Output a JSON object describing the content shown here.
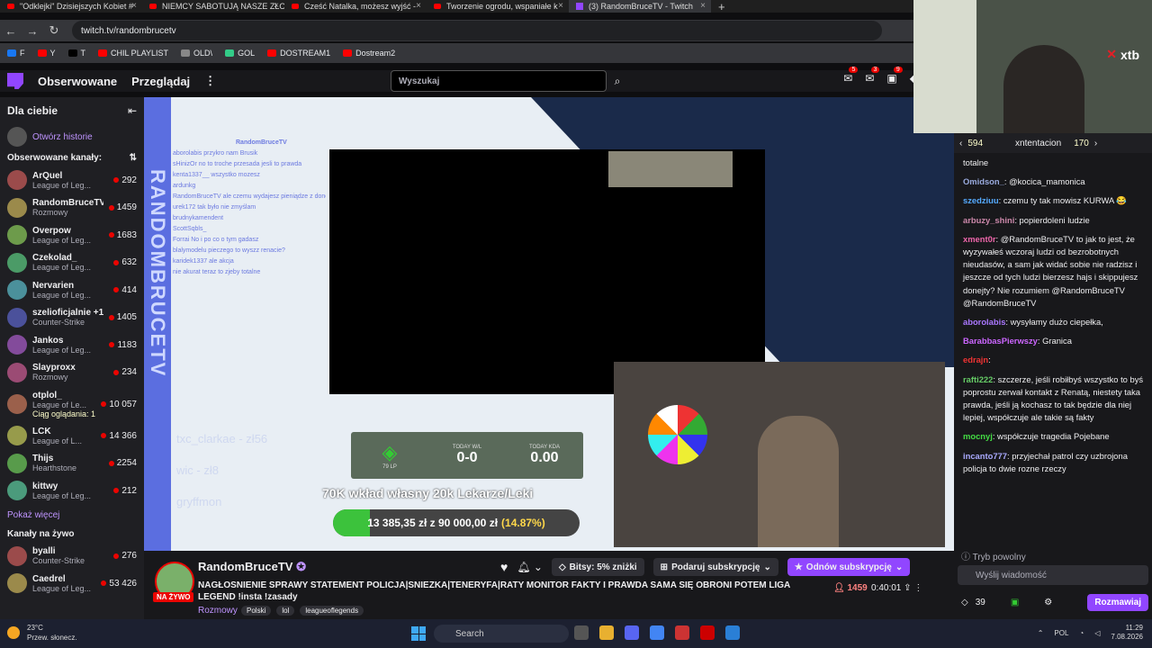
{
  "browser": {
    "tabs": [
      {
        "label": "\"Odklejki\" Dzisiejszych Kobiet #",
        "kind": "youtube"
      },
      {
        "label": "NIEMCY SABOTUJĄ NASZE ZŁO",
        "kind": "youtube"
      },
      {
        "label": "Cześć Natalka, możesz wyjść -",
        "kind": "youtube"
      },
      {
        "label": "Tworzenie ogrodu, wspaniałe k",
        "kind": "youtube"
      },
      {
        "label": "(3) RandomBruceTV - Twitch",
        "kind": "twitch",
        "active": true
      }
    ],
    "url": "twitch.tv/randombrucetv",
    "bookmarks": [
      "F",
      "Y",
      "T",
      "CHIL PLAYLIST",
      "OLD\\",
      "GOL",
      "DOSTREAM1",
      "Dostream2"
    ]
  },
  "twitch": {
    "nav": {
      "following": "Obserwowane",
      "browse": "Przeglądaj",
      "search_placeholder": "Wyszukaj",
      "badges": [
        "5",
        "3",
        "9"
      ]
    },
    "sidebar": {
      "for_you": "Dla ciebie",
      "open_stories": "Otwórz historie",
      "followed_header": "Obserwowane kanały:",
      "channels": [
        {
          "name": "ArQuel",
          "game": "League of Leg...",
          "viewers": "292"
        },
        {
          "name": "RandomBruceTV",
          "game": "Rozmowy",
          "viewers": "1459"
        },
        {
          "name": "Overpow",
          "game": "League of Leg...",
          "viewers": "1683"
        },
        {
          "name": "Czekolad_",
          "game": "League of Leg...",
          "viewers": "632"
        },
        {
          "name": "Nervarien",
          "game": "League of Leg...",
          "viewers": "414"
        },
        {
          "name": "szelioficjalnie +1",
          "game": "Counter-Strike",
          "viewers": "1405"
        },
        {
          "name": "Jankos",
          "game": "League of Leg...",
          "viewers": "1183"
        },
        {
          "name": "Slayproxx",
          "game": "Rozmowy",
          "viewers": "234"
        },
        {
          "name": "otplol_",
          "game": "League of Le...",
          "viewers": "10 057",
          "extra": "Ciąg oglądania: 1"
        },
        {
          "name": "LCK",
          "game": "League of L...",
          "viewers": "14 366"
        },
        {
          "name": "Thijs",
          "game": "Hearthstone",
          "viewers": "2254"
        },
        {
          "name": "kittwy",
          "game": "League of Leg...",
          "viewers": "212"
        }
      ],
      "show_more": "Pokaż więcej",
      "live_header": "Kanały na żywo",
      "live": [
        {
          "name": "byalli",
          "game": "Counter-Strike",
          "viewers": "276"
        },
        {
          "name": "Caedrel",
          "game": "League of Leg...",
          "viewers": "53 426"
        }
      ]
    },
    "stream_overlay": {
      "vertical_title": "RANDOMBRUCETV",
      "chat_header": "RandomBruceTV",
      "chat_lines": [
        "aborolabis przykro nam Brusik",
        "sHinizOr no to troche przesada jesli to prawda",
        "kenta1337__ wszystko mozesz",
        "ardunkg",
        "RandomBruceTV ale czemu wydajesz pieniądze z donejt goala na Teneryfe na procesor, monitor i płytę główną",
        "urek172 tak było nie zmyślam",
        "brudnykamendent",
        "ScottSqbls_",
        "Forrai No i po co o tym gadasz",
        "blalymodelu pieczego to wyszz renacie?",
        "karidek1337 ale akcja",
        "nie akurat teraz to zjeby totalne"
      ],
      "names": [
        "txc_clarkae - zł56",
        "wic - zł8",
        "gryffmon"
      ],
      "stats": {
        "rank_lp": "79 LP",
        "wl_label": "TODAY W/L",
        "wl": "0-0",
        "kda_label": "TODAY KDA",
        "kda": "0.00"
      },
      "goal_title": "70K wkład własny 20k Lekarze/Leki",
      "goal_text": "13 385,35 zł z 90 000,00 zł",
      "goal_pct": "(14.87%)",
      "goal_fraction": 0.1487
    },
    "stream_info": {
      "streamer": "RandomBruceTV",
      "live_label": "NA ŻYWO",
      "title": "NAGŁOSNIENIE SPRAWY STATEMENT POLICJA|SNIEZKA|TENERYFA|RATY MONITOR FAKTY I PRAWDA SAMA SIĘ OBRONI POTEM LIGA LEGEND !insta !zasady",
      "category": "Rozmowy",
      "tags": [
        "Polski",
        "lol",
        "leagueoflegends"
      ],
      "bits": "Bitsy: 5% zniżki",
      "gift": "Podaruj subskrypcję",
      "renew": "Odnów subskrypcję",
      "viewers": "1459",
      "uptime": "0:40:01"
    },
    "chat": {
      "top": {
        "count1": "594",
        "user": "xntentacion",
        "count2": "170"
      },
      "messages": [
        {
          "user": "",
          "text": "totalne",
          "color": "#efeff1"
        },
        {
          "user": "Omidson_",
          "text": "@kocica_mamonica",
          "color": "#9ad"
        },
        {
          "user": "szedziuu",
          "text": "czemu ty tak mowisz KURWA 😂",
          "color": "#5af"
        },
        {
          "user": "arbuzy_shini",
          "text": "popierdoleni ludzie",
          "color": "#c8a"
        },
        {
          "user": "xment0r",
          "text": "@RandomBruceTV to jak to jest, że wyzywałeś wczoraj ludzi od bezrobotnych nieudasów, a sam jak widać sobie nie radzisz i jeszcze od tych ludzi bierzesz hajs i skippujesz donejty? Nie rozumiem @RandomBruceTV @RandomBruceTV",
          "color": "#e6a"
        },
        {
          "user": "aborolabis",
          "text": "wysyłamy dużo ciepełka,",
          "color": "#a7f"
        },
        {
          "user": "BarabbasPierwszy",
          "text": "Granica",
          "color": "#c6f"
        },
        {
          "user": "edrajn",
          "text": "",
          "color": "#e33"
        },
        {
          "user": "rafti222",
          "text": "szczerze, jeśli robiłbyś wszystko to byś poprostu zerwał kontakt z Renatą, niestety taka prawda, jeśli ją kochasz to tak będzie dla niej lepiej, współczuje ale takie są fakty",
          "color": "#6c6"
        },
        {
          "user": "mocnyj",
          "text": "współczuje tragedia Pojebane",
          "color": "#4d4"
        },
        {
          "user": "incanto777",
          "text": "przyjechał patrol czy uzbrojona policja to dwie rozne rzeczy",
          "color": "#aaf"
        }
      ],
      "mode": "Tryb powolny",
      "input_placeholder": "Wyślij wiadomość",
      "points": "39",
      "send": "Rozmawiaj"
    }
  },
  "webcam": {
    "brand": "xtb"
  },
  "taskbar": {
    "temp": "23°C",
    "weather": "Przew. słonecz.",
    "search": "Search",
    "lang": "POL",
    "time": "11:29",
    "date": "7.08.2026"
  }
}
